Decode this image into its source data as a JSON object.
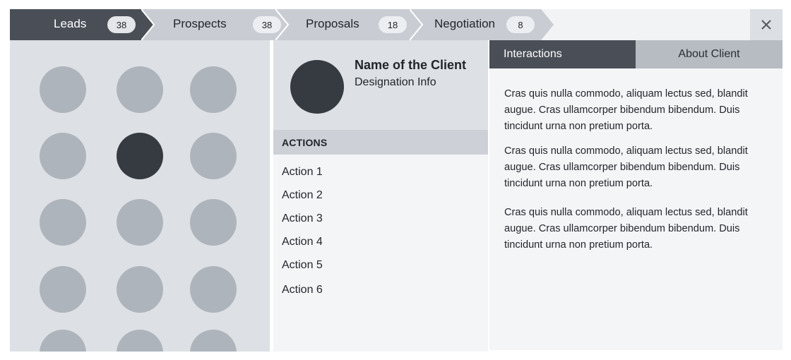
{
  "pipeline": {
    "stages": [
      {
        "label": "Leads",
        "count": "38"
      },
      {
        "label": "Prospects",
        "count": "38"
      },
      {
        "label": "Proposals",
        "count": "18"
      },
      {
        "label": "Negotiation",
        "count": "8"
      }
    ],
    "active_stage": "Leads",
    "close_icon": "close-icon"
  },
  "client": {
    "name": "Name of the Client",
    "designation": "Designation Info",
    "avatar_icon": "avatar"
  },
  "actions": {
    "header": "ACTIONS",
    "items": [
      "Action 1",
      "Action 2",
      "Action 3",
      "Action 4",
      "Action 5",
      "Action 6"
    ]
  },
  "detail": {
    "tabs": [
      {
        "label": "Interactions",
        "active": true
      },
      {
        "label": "About Client",
        "active": false
      }
    ],
    "paragraphs": [
      "Cras quis nulla commodo, aliquam lectus sed, blandit augue. Cras ullamcorper bibendum bibendum. Duis tincidunt urna non pretium porta.",
      "Cras quis nulla commodo, aliquam lectus sed, blandit augue. Cras ullamcorper bibendum bibendum. Duis tincidunt urna non pretium porta.",
      "Cras quis nulla commodo, aliquam lectus sed, blandit augue. Cras ullamcorper bibendum bibendum. Duis tincidunt urna non pretium porta."
    ]
  },
  "lead_grid": {
    "selected_index": 4
  },
  "colors": {
    "active_stage": "#4a4f57",
    "inactive_stage": "#c9cdd3",
    "dot": "#aeb4bb",
    "dot_selected": "#363a41"
  }
}
